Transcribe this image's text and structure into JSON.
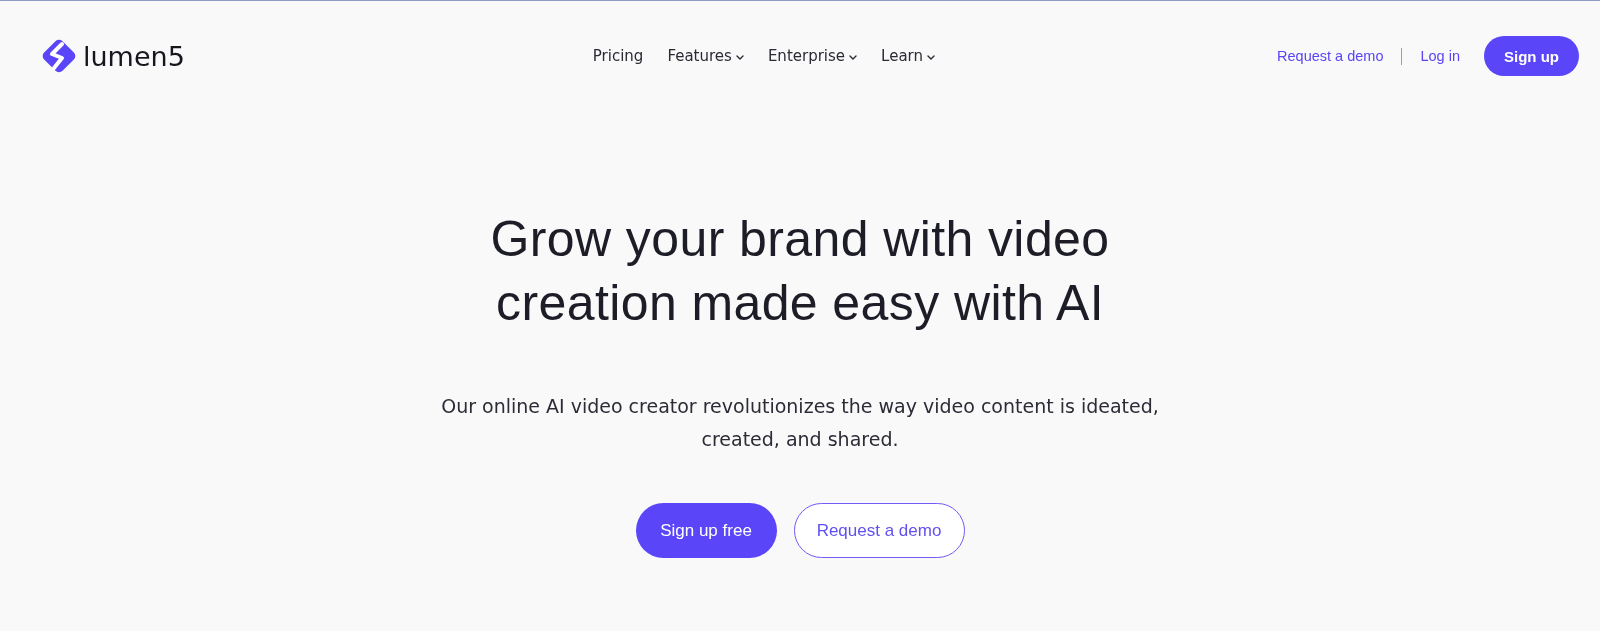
{
  "header": {
    "logo": {
      "text": "lumen5"
    },
    "nav": [
      {
        "label": "Pricing",
        "dropdown": false
      },
      {
        "label": "Features",
        "dropdown": true
      },
      {
        "label": "Enterprise",
        "dropdown": true
      },
      {
        "label": "Learn",
        "dropdown": true
      }
    ],
    "actions": [
      {
        "label": "Request a demo",
        "kind": "link"
      },
      {
        "label": "Log in",
        "kind": "link"
      },
      {
        "label": "Sign up",
        "kind": "button"
      }
    ]
  },
  "hero": {
    "heading": "Grow your brand with video creation made easy with AI",
    "description": "Our online AI video creator revolutionizes the way video content is ideated, created, and shared.",
    "buttons": [
      {
        "label": "Sign up free",
        "kind": "primary"
      },
      {
        "label": "Request a demo",
        "kind": "secondary"
      }
    ]
  }
}
